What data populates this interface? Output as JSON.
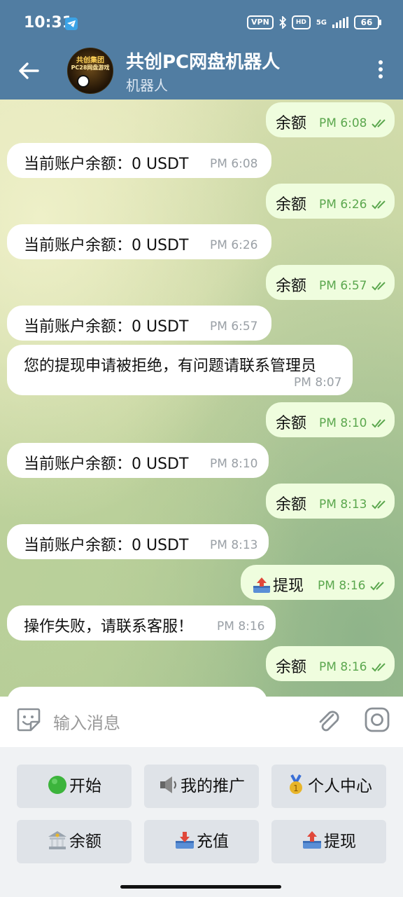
{
  "status_bar": {
    "time": "10:31",
    "vpn": "VPN",
    "hd": "HD",
    "network": "5G",
    "battery": "66"
  },
  "header": {
    "title": "共创PC网盘机器人",
    "subtitle": "机器人",
    "avatar_text_top": "共创集团",
    "avatar_text_bottom": "PC28网盘游戏",
    "color": "#517da2"
  },
  "messages": [
    {
      "dir": "out",
      "text": "余额",
      "time": "PM 6:08"
    },
    {
      "dir": "in",
      "text": "当前账户余额：0 USDT",
      "time": "PM 6:08"
    },
    {
      "dir": "out",
      "text": "余额",
      "time": "PM 6:26"
    },
    {
      "dir": "in",
      "text": "当前账户余额：0 USDT",
      "time": "PM 6:26"
    },
    {
      "dir": "out",
      "text": "余额",
      "time": "PM 6:57"
    },
    {
      "dir": "in",
      "text": "当前账户余额：0 USDT",
      "time": "PM 6:57"
    },
    {
      "dir": "in",
      "text": "您的提现申请被拒绝，有问题请联系管理员",
      "time": "PM 8:07"
    },
    {
      "dir": "out",
      "text": "余额",
      "time": "PM 8:10"
    },
    {
      "dir": "in",
      "text": "当前账户余额：0 USDT",
      "time": "PM 8:10"
    },
    {
      "dir": "out",
      "text": "余额",
      "time": "PM 8:13"
    },
    {
      "dir": "in",
      "text": "当前账户余额：0 USDT",
      "time": "PM 8:13"
    },
    {
      "dir": "out",
      "text": "提现",
      "icon": "outbox-tray-icon",
      "time": "PM 8:16"
    },
    {
      "dir": "in",
      "text": "操作失败，请联系客服！",
      "time": "PM 8:16"
    },
    {
      "dir": "out",
      "text": "余额",
      "time": "PM 8:16"
    }
  ],
  "input": {
    "placeholder": "输入消息"
  },
  "keyboard": [
    {
      "label": "开始",
      "icon": "green-circle-icon"
    },
    {
      "label": "我的推广",
      "icon": "speaker-icon"
    },
    {
      "label": "个人中心",
      "icon": "medal-icon"
    },
    {
      "label": "余额",
      "icon": "bank-icon"
    },
    {
      "label": "充值",
      "icon": "inbox-tray-icon"
    },
    {
      "label": "提现",
      "icon": "outbox-tray-icon"
    }
  ],
  "colors": {
    "incoming_bubble": "#ffffff",
    "outgoing_bubble": "#effdde",
    "read_ticks": "#5ba74e"
  }
}
